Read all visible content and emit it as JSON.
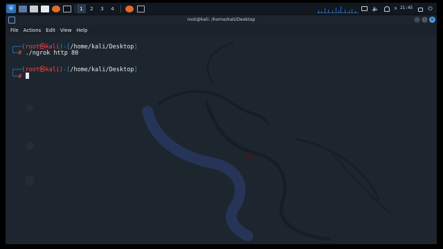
{
  "panel": {
    "workspaces": [
      "1",
      "2",
      "3",
      "4"
    ],
    "active_workspace": "1",
    "clock": "21:45",
    "icons": [
      "kali-menu-icon",
      "desktop-icon",
      "files-icon",
      "terminal-icon",
      "firefox-icon",
      "terminal-window-icon"
    ]
  },
  "window": {
    "title": "root@kali: /home/kali/Desktop"
  },
  "menu": [
    "File",
    "Actions",
    "Edit",
    "View",
    "Help"
  ],
  "terminal": {
    "prompt_user": "root",
    "prompt_host": "kali",
    "prompt_skull": "㉿",
    "prompt_path": "/home/kali/Desktop",
    "prompt_symbol": "#",
    "command1": "./ngrok http 80",
    "command2": ""
  },
  "colors": {
    "prompt_frame": "#3a8ad8",
    "prompt_user": "#ff4444",
    "background": "#1d252e"
  }
}
